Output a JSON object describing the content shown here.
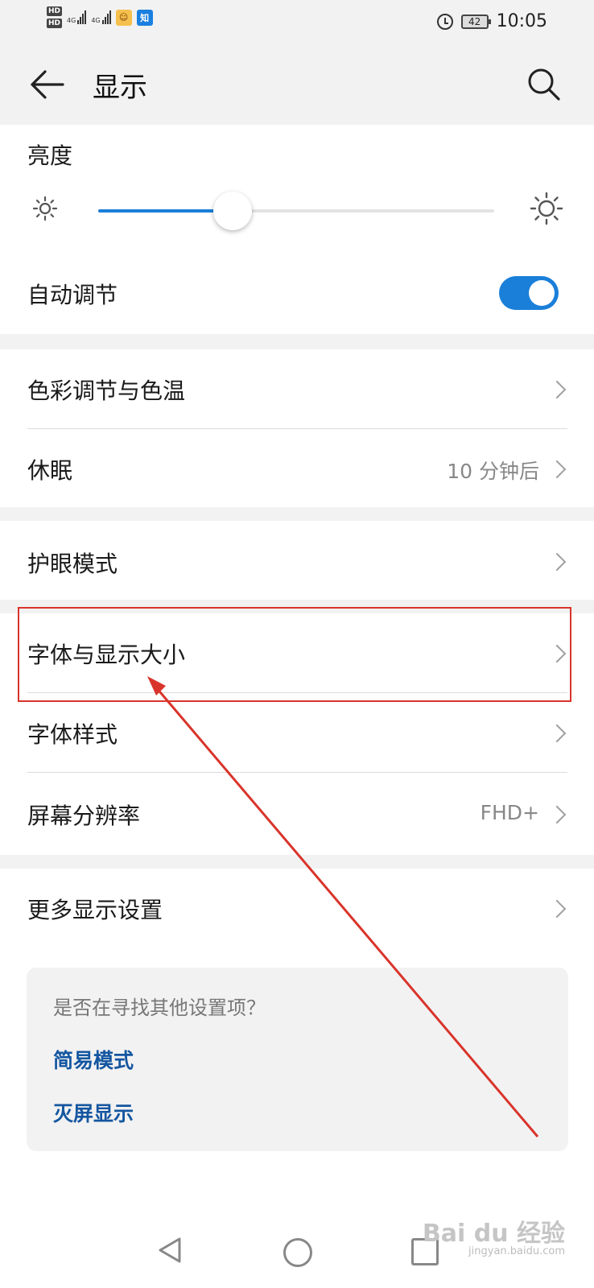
{
  "status_bar": {
    "hd1": "HD",
    "hd2": "HD",
    "signal1_label": "4G",
    "signal2_label": "4G",
    "battery": "42",
    "time": "10:05",
    "icons": [
      "alarm-icon",
      "battery-icon",
      "game-app-icon",
      "zhihu-app-icon"
    ],
    "zhihu_glyph": "知"
  },
  "header": {
    "title": "显示"
  },
  "brightness": {
    "label": "亮度",
    "level_fraction": 0.34,
    "accent": "#1a7fd9"
  },
  "auto_adjust": {
    "label": "自动调节",
    "enabled": true
  },
  "rows": {
    "color_temp": "色彩调节与色温",
    "sleep": "休眠",
    "sleep_value": "10 分钟后",
    "eye_care": "护眼模式",
    "font_size": "字体与显示大小",
    "font_style": "字体样式",
    "resolution": "屏幕分辨率",
    "resolution_value": "FHD+",
    "more_settings": "更多显示设置"
  },
  "suggestions": {
    "question": "是否在寻找其他设置项？",
    "link1": "简易模式",
    "link2": "灭屏显示"
  },
  "annotation": {
    "highlight_color": "#d9342b"
  },
  "watermark": {
    "brand": "Bai du 经验",
    "url": "jingyan.baidu.com"
  }
}
